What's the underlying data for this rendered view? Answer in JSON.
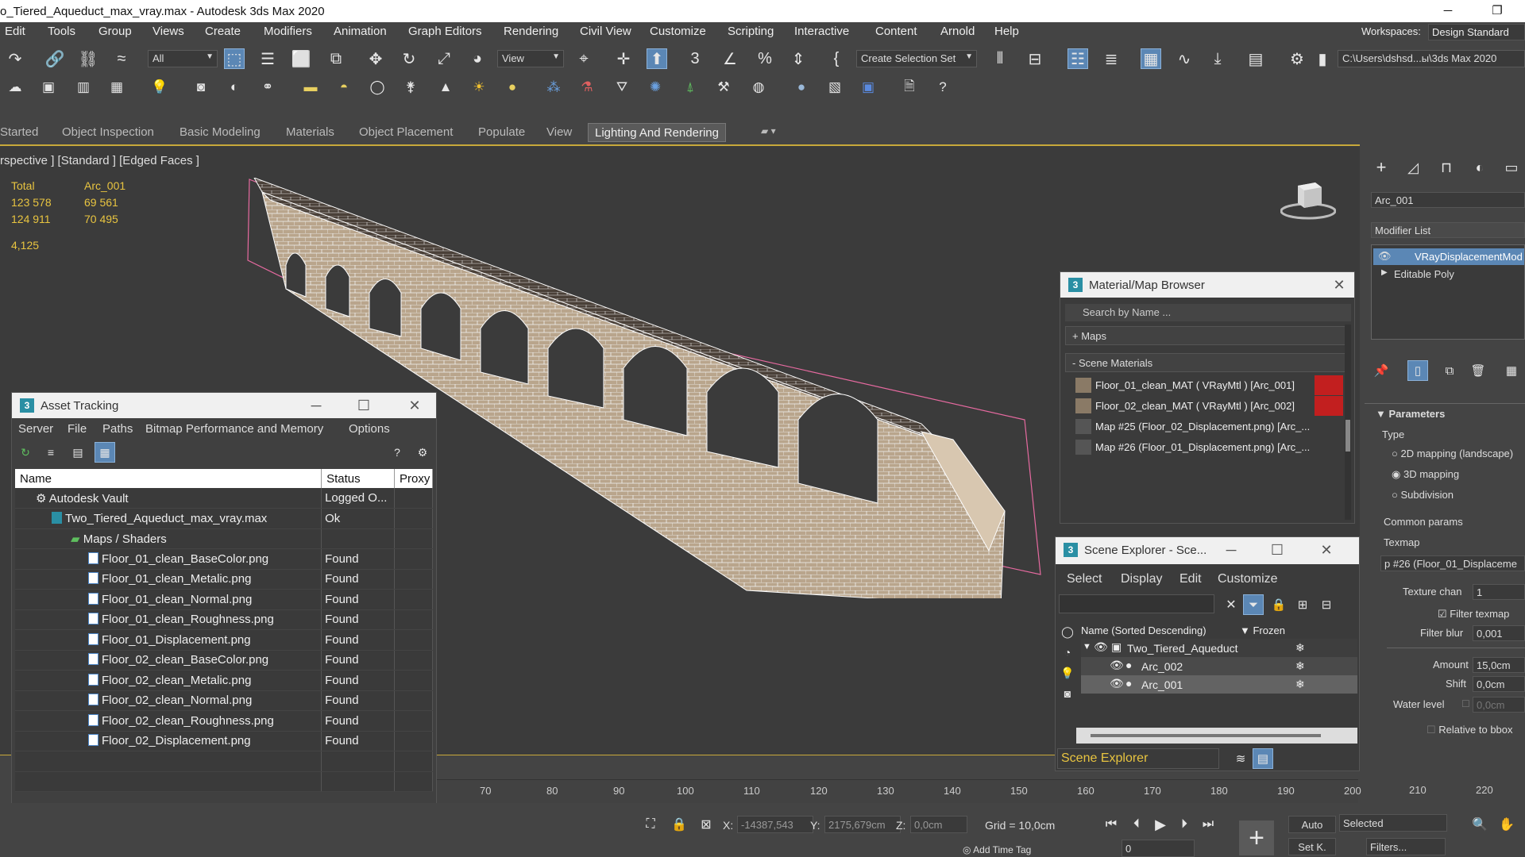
{
  "window": {
    "title": "o_Tiered_Aqueduct_max_vray.max - Autodesk 3ds Max 2020",
    "minimize": "─",
    "restore": "❐"
  },
  "menubar": {
    "items": [
      "Edit",
      "Tools",
      "Group",
      "Views",
      "Create",
      "Modifiers",
      "Animation",
      "Graph Editors",
      "Rendering",
      "Civil View",
      "Customize",
      "Scripting",
      "Interactive",
      "Content",
      "Arnold",
      "Help"
    ],
    "workspaces_label": "Workspaces:",
    "workspace_value": "Design Standard"
  },
  "toolbar": {
    "selection_filter": "All",
    "ref_coord": "View",
    "named_selection": "Create Selection Set",
    "project_path": "C:\\Users\\dshsd...ы\\3ds Max 2020"
  },
  "ribbon": {
    "tabs": [
      "Started",
      "Object Inspection",
      "Basic Modeling",
      "Materials",
      "Object Placement",
      "Populate",
      "View",
      "Lighting And Rendering"
    ],
    "active": "Lighting And Rendering"
  },
  "viewport": {
    "label": "rspective ] [Standard ] [Edged Faces ]",
    "stats": {
      "col1": [
        "Total",
        "123 578",
        "124 911"
      ],
      "col2": [
        "Arc_001",
        "69 561",
        "70 495"
      ],
      "fps": "4,125"
    }
  },
  "asset_tracking": {
    "title": "Asset Tracking",
    "menu": [
      "Server",
      "File",
      "Paths",
      "Bitmap Performance and Memory",
      "Options"
    ],
    "columns": [
      "Name",
      "Status",
      "Proxy"
    ],
    "rows": [
      {
        "name": "Autodesk Vault",
        "status": "Logged O..."
      },
      {
        "name": "Two_Tiered_Aqueduct_max_vray.max",
        "status": "Ok"
      },
      {
        "name": "Maps / Shaders",
        "status": ""
      },
      {
        "name": "Floor_01_clean_BaseColor.png",
        "status": "Found"
      },
      {
        "name": "Floor_01_clean_Metalic.png",
        "status": "Found"
      },
      {
        "name": "Floor_01_clean_Normal.png",
        "status": "Found"
      },
      {
        "name": "Floor_01_clean_Roughness.png",
        "status": "Found"
      },
      {
        "name": "Floor_01_Displacement.png",
        "status": "Found"
      },
      {
        "name": "Floor_02_clean_BaseColor.png",
        "status": "Found"
      },
      {
        "name": "Floor_02_clean_Metalic.png",
        "status": "Found"
      },
      {
        "name": "Floor_02_clean_Normal.png",
        "status": "Found"
      },
      {
        "name": "Floor_02_clean_Roughness.png",
        "status": "Found"
      },
      {
        "name": "Floor_02_Displacement.png",
        "status": "Found"
      }
    ]
  },
  "material_browser": {
    "title": "Material/Map Browser",
    "search_placeholder": "Search by Name ...",
    "maps_label": "+ Maps",
    "scene_materials_label": "- Scene Materials",
    "items": [
      "Floor_01_clean_MAT  ( VRayMtl )  [Arc_001]",
      "Floor_02_clean_MAT  ( VRayMtl )  [Arc_002]",
      "Map #25 (Floor_02_Displacement.png)  [Arc_...",
      "Map #26 (Floor_01_Displacement.png)  [Arc_..."
    ]
  },
  "scene_explorer": {
    "title": "Scene Explorer - Sce...",
    "menu": [
      "Select",
      "Display",
      "Edit",
      "Customize"
    ],
    "col_name": "Name (Sorted Descending)",
    "col_frozen": "▼ Frozen",
    "rows": [
      "Two_Tiered_Aqueduct",
      "Arc_002",
      "Arc_001"
    ],
    "footer": "Scene Explorer"
  },
  "command_panel": {
    "object_name": "Arc_001",
    "modifier_list": "Modifier List",
    "modifiers": [
      "VRayDisplacementMod",
      "Editable Poly"
    ],
    "parameters": "Parameters",
    "type_label": "Type",
    "type_options": [
      "2D mapping (landscape)",
      "3D mapping",
      "Subdivision"
    ],
    "common_params": "Common params",
    "texmap_label": "Texmap",
    "texmap_value": "p #26 (Floor_01_Displaceme",
    "texture_chan_label": "Texture chan",
    "texture_chan_value": "1",
    "filter_texmap": "Filter texmap",
    "filter_blur_label": "Filter blur",
    "filter_blur_value": "0,001",
    "amount_label": "Amount",
    "amount_value": "15,0cm",
    "shift_label": "Shift",
    "shift_value": "0,0cm",
    "water_label": "Water level",
    "water_value": "0,0cm",
    "relative_bbox": "Relative to bbox"
  },
  "timeline": {
    "ticks": [
      "70",
      "80",
      "90",
      "100",
      "110",
      "120",
      "130",
      "140",
      "150",
      "160",
      "170",
      "180",
      "190",
      "200",
      "210",
      "220"
    ]
  },
  "status": {
    "x_label": "X:",
    "x_value": "-14387,543",
    "y_label": "Y:",
    "y_value": "2175,679cm",
    "z_label": "Z:",
    "z_value": "0,0cm",
    "grid": "Grid = 10,0cm",
    "add_time_tag": "Add Time Tag",
    "auto": "Auto",
    "selected": "Selected",
    "set_key": "Set K.",
    "filters": "Filters...",
    "frame": "0"
  }
}
